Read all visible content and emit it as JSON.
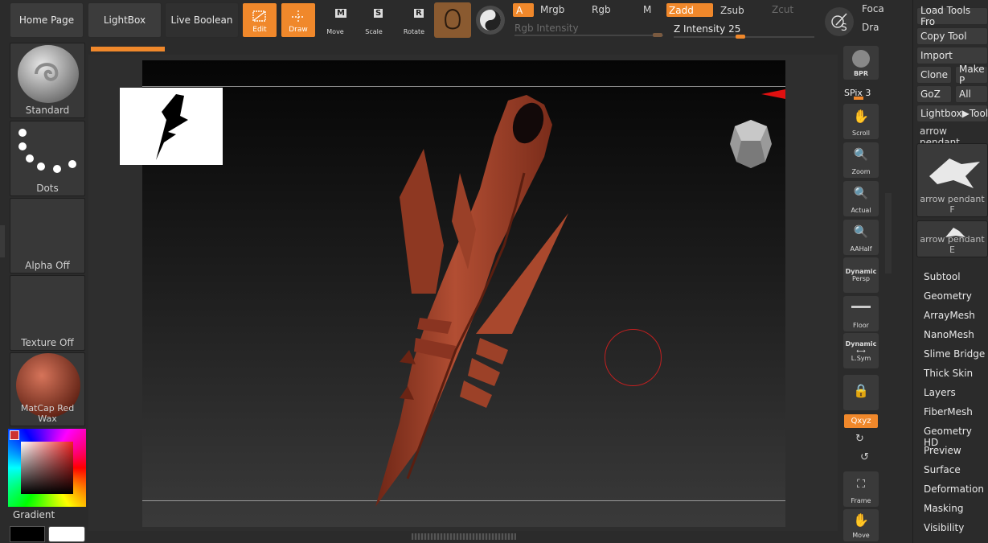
{
  "top": {
    "home_page": "Home Page",
    "lightbox": "LightBox",
    "live_boolean": "Live Boolean",
    "edit": "Edit",
    "draw": "Draw",
    "move": "Move",
    "scale": "Scale",
    "rotate": "Rotate",
    "move_key": "M",
    "scale_key": "S",
    "rotate_key": "R",
    "a": "A",
    "mrgb": "Mrgb",
    "rgb": "Rgb",
    "m": "M",
    "zadd": "Zadd",
    "zsub": "Zsub",
    "zcut": "Zcut",
    "rgb_intensity": "Rgb Intensity",
    "z_intensity": "Z Intensity 25",
    "focal": "Foca",
    "draw_size": "Dra",
    "s_key": "S"
  },
  "left": {
    "standard": "Standard",
    "dots": "Dots",
    "alpha_off": "Alpha Off",
    "texture_off": "Texture Off",
    "matcap": "MatCap Red Wax",
    "gradient": "Gradient"
  },
  "nav": {
    "bpr": "BPR",
    "spix": "SPix 3",
    "scroll": "Scroll",
    "zoom": "Zoom",
    "actual": "Actual",
    "aahalf": "AAHalf",
    "dynamic1": "Dynamic",
    "persp": "Persp",
    "floor": "Floor",
    "dynamic2": "Dynamic",
    "lsym": "L.Sym",
    "xyz": "Qxyz",
    "frame": "Frame",
    "move": "Move"
  },
  "right": {
    "load_tools": "Load Tools Fro",
    "copy_tool": "Copy Tool",
    "import": "Import",
    "clone": "Clone",
    "make": "Make P",
    "goz": "GoZ",
    "all": "All",
    "lightbox_tools": "Lightbox▶Tools",
    "current_tool": "arrow pendant",
    "thumb1": "arrow pendant F",
    "thumb2": "arrow pendant E",
    "menu": [
      "Subtool",
      "Geometry",
      "ArrayMesh",
      "NanoMesh",
      "Slime Bridge",
      "Thick Skin",
      "Layers",
      "FiberMesh",
      "Geometry HD",
      "Preview",
      "Surface",
      "Deformation",
      "Masking",
      "Visibility"
    ]
  },
  "colors": {
    "accent": "#f0882b",
    "model": "#a4432c",
    "panel": "#2b2b2b"
  }
}
